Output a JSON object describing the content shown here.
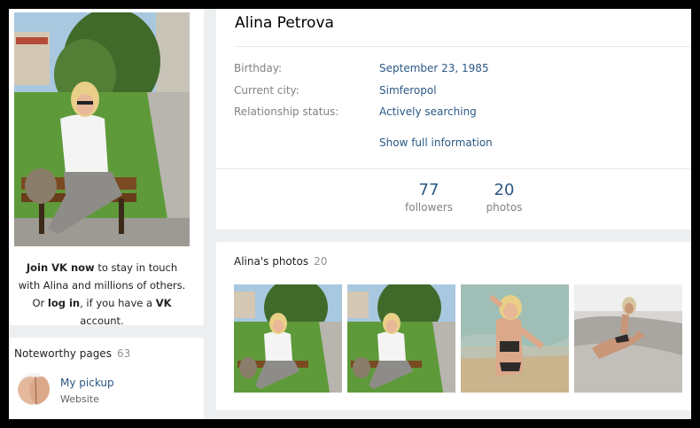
{
  "sidebar": {
    "join": {
      "join_link": "Join VK now",
      "text1": " to stay in touch with Alina and millions of others.",
      "or": "Or ",
      "login_link": "log in",
      "text2": ", if you have a ",
      "vk": "VK",
      "text3": " account."
    },
    "noteworthy": {
      "title": "Noteworthy pages",
      "count": "63",
      "items": [
        {
          "name": "My pickup",
          "type": "Website"
        }
      ]
    }
  },
  "profile": {
    "name": "Alina Petrova",
    "fields": [
      {
        "label": "Birthday:",
        "value": "September 23, 1985"
      },
      {
        "label": "Current city:",
        "value": "Simferopol"
      },
      {
        "label": "Relationship status:",
        "value": "Actively searching"
      }
    ],
    "show_full": "Show full information",
    "counters": [
      {
        "num": "77",
        "label": "followers"
      },
      {
        "num": "20",
        "label": "photos"
      }
    ]
  },
  "photos": {
    "title": "Alina's photos",
    "count": "20"
  }
}
